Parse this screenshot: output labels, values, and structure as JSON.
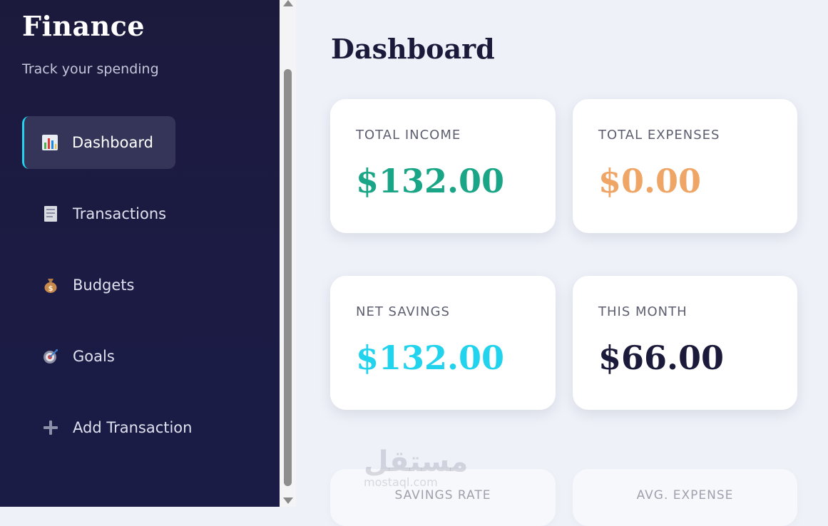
{
  "sidebar": {
    "title": "Finance",
    "subtitle": "Track your spending",
    "items": [
      {
        "label": "Dashboard",
        "icon": "bar-chart-icon",
        "active": true
      },
      {
        "label": "Transactions",
        "icon": "receipt-icon",
        "active": false
      },
      {
        "label": "Budgets",
        "icon": "money-bag-icon",
        "active": false
      },
      {
        "label": "Goals",
        "icon": "target-icon",
        "active": false
      },
      {
        "label": "Add Transaction",
        "icon": "plus-icon",
        "active": false
      }
    ]
  },
  "main": {
    "title": "Dashboard",
    "cards": [
      {
        "label": "TOTAL INCOME",
        "value": "$132.00",
        "color": "#1aa586"
      },
      {
        "label": "TOTAL EXPENSES",
        "value": "$0.00",
        "color": "#eea566"
      },
      {
        "label": "NET SAVINGS",
        "value": "$132.00",
        "color": "#22d3ee"
      },
      {
        "label": "THIS MONTH",
        "value": "$66.00",
        "color": "#1b1a3a"
      },
      {
        "label": "SAVINGS RATE"
      },
      {
        "label": "AVG. EXPENSE"
      }
    ]
  },
  "watermark": {
    "arabic": "مستقل",
    "latin": "mostaql.com"
  },
  "colors": {
    "accent": "#22d3ee",
    "sidebar_bg": "#1c1a3c"
  }
}
